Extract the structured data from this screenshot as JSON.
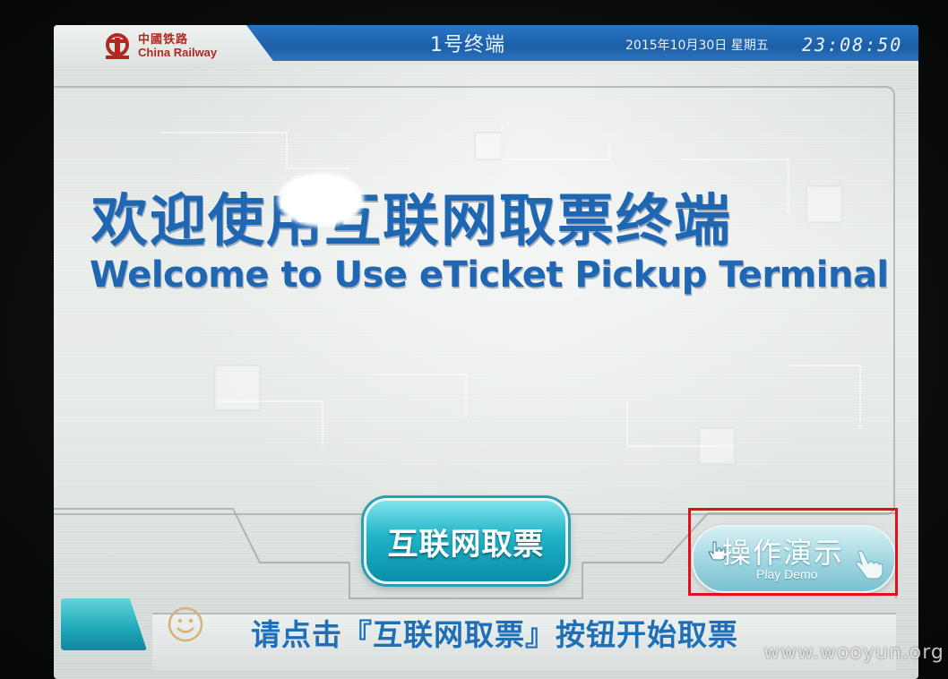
{
  "header": {
    "logo_cn": "中國铁路",
    "logo_en": "China Railway",
    "terminal_title": "1号终端",
    "date": "2015年10月30日 星期五",
    "time": "23:08:50"
  },
  "welcome": {
    "title_cn": "欢迎使用互联网取票终端",
    "title_en": "Welcome to Use eTicket Pickup Terminal"
  },
  "buttons": {
    "pickup_label": "互联网取票",
    "demo_label_cn": "操作演示",
    "demo_label_en": "Play Demo"
  },
  "footer": {
    "instruction": "请点击『互联网取票』按钮开始取票"
  },
  "watermark": "www.wooyun.org",
  "colors": {
    "brand_blue": "#1f66b3",
    "button_teal": "#1eb3c7",
    "highlight_red": "#e3101c",
    "logo_red": "#b1281f"
  }
}
